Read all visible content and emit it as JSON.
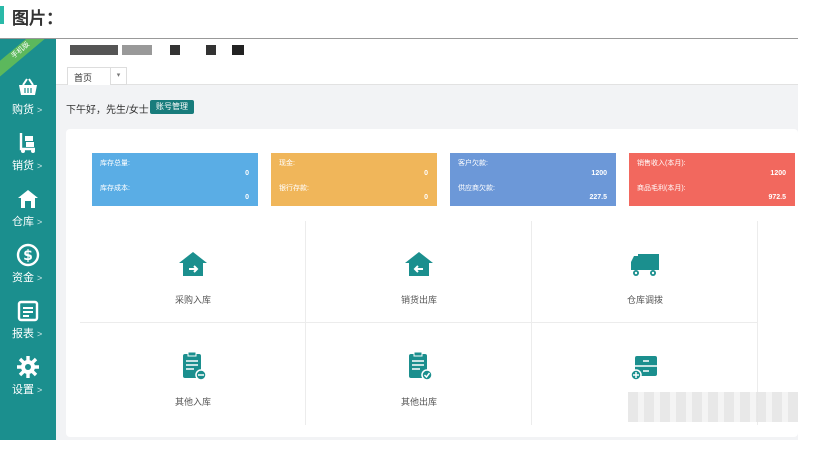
{
  "heading": {
    "text": "图片："
  },
  "sidebar": {
    "badge": "手机版",
    "items": [
      {
        "label": "购货",
        "icon": "basket-icon"
      },
      {
        "label": "销货",
        "icon": "trolley-icon"
      },
      {
        "label": "仓库",
        "icon": "warehouse-icon"
      },
      {
        "label": "资金",
        "icon": "dollar-icon"
      },
      {
        "label": "报表",
        "icon": "report-icon"
      },
      {
        "label": "设置",
        "icon": "gear-icon"
      }
    ],
    "arrow": ">"
  },
  "tabs": {
    "home": "首页",
    "dropdown": "▾"
  },
  "greeting": {
    "text": "下午好，先生/女士",
    "account_button": "账号管理"
  },
  "cards": [
    {
      "color": "#5aade5",
      "k1": "库存总量:",
      "v1": "0",
      "k2": "库存成本:",
      "v2": "0"
    },
    {
      "color": "#f0b65a",
      "k1": "现金:",
      "v1": "0",
      "k2": "银行存款:",
      "v2": "0"
    },
    {
      "color": "#6c98d8",
      "k1": "客户欠款:",
      "v1": "1200",
      "k2": "供应商欠款:",
      "v2": "227.5"
    },
    {
      "color": "#f2685e",
      "k1": "销售收入(本月):",
      "v1": "1200",
      "k2": "商品毛利(本月):",
      "v2": "972.5"
    }
  ],
  "tiles": [
    {
      "label": "采购入库",
      "icon": "house-in-icon"
    },
    {
      "label": "销货出库",
      "icon": "house-out-icon"
    },
    {
      "label": "仓库调拨",
      "icon": "truck-icon"
    },
    {
      "label": "其他入库",
      "icon": "clipboard-in-icon"
    },
    {
      "label": "其他出库",
      "icon": "clipboard-out-icon"
    },
    {
      "label": "",
      "icon": "cabinet-add-icon"
    }
  ],
  "colors": {
    "sidebar": "#1b8f8e",
    "accent": "#187c7c",
    "icon": "#1b8f8e"
  }
}
